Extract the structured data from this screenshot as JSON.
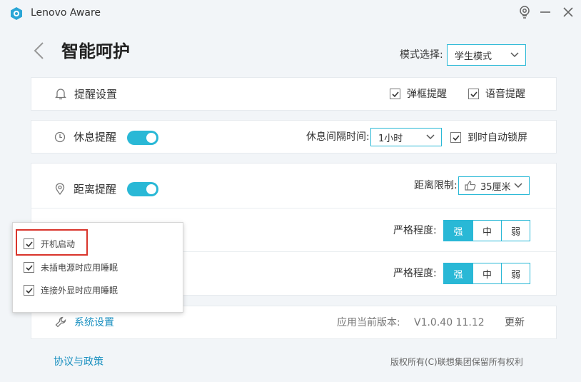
{
  "app": {
    "title": "Lenovo Aware"
  },
  "window_controls": {
    "icons": [
      "lightbulb-icon",
      "minimize-icon",
      "close-icon"
    ]
  },
  "header": {
    "title": "智能呵护",
    "mode_label": "模式选择:",
    "mode_value": "学生模式"
  },
  "reminder_settings": {
    "label": "提醒设置",
    "popup_checkbox": "弹框提醒",
    "voice_checkbox": "语音提醒"
  },
  "rest_reminder": {
    "label": "休息提醒",
    "enabled": true,
    "interval_label": "休息间隔时间:",
    "interval_value": "1小时",
    "auto_lock_label": "到时自动锁屏"
  },
  "distance_reminder": {
    "label": "距离提醒",
    "enabled": true,
    "limit_label": "距离限制:",
    "limit_value": "35厘米"
  },
  "strictness_rows": [
    {
      "label": "严格程度:",
      "options": [
        "强",
        "中",
        "弱"
      ],
      "selected": 0
    },
    {
      "label": "严格程度:",
      "options": [
        "强",
        "中",
        "弱"
      ],
      "selected": 0
    }
  ],
  "popup_menu": {
    "items": [
      {
        "label": "开机启动",
        "checked": true
      },
      {
        "label": "未插电源时应用睡眠",
        "checked": true
      },
      {
        "label": "连接外显时应用睡眠",
        "checked": true
      }
    ]
  },
  "system": {
    "settings_label": "系统设置",
    "version_label": "应用当前版本:",
    "version_value": "V1.0.40 11.12",
    "update_label": "更新"
  },
  "footer": {
    "policy_link": "协议与政策",
    "copyright": "版权所有(C)联想集团保留所有权利"
  },
  "colors": {
    "accent": "#29b8d6",
    "highlight": "#d9342b",
    "link": "#1a90c0"
  }
}
